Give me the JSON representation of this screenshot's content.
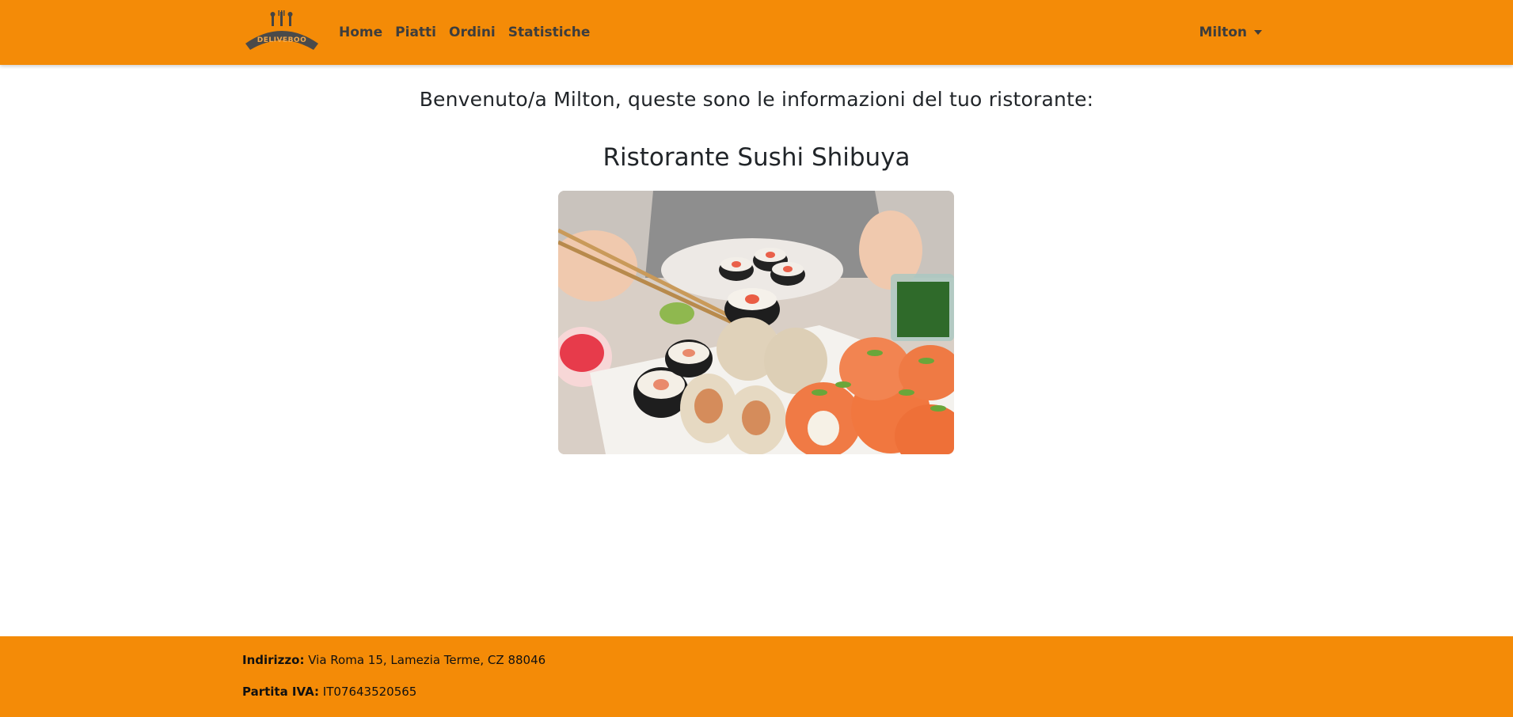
{
  "navbar": {
    "logo_text": "DELIVEBOO",
    "links": [
      "Home",
      "Piatti",
      "Ordini",
      "Statistiche"
    ],
    "user_name": "Milton"
  },
  "main": {
    "welcome": "Benvenuto/a Milton, queste sono le informazioni del tuo ristorante:",
    "restaurant_name": "Ristorante Sushi Shibuya"
  },
  "footer": {
    "address_label": "Indirizzo:",
    "address_value": "Via Roma 15, Lamezia Terme, CZ 88046",
    "vat_label": "Partita IVA:",
    "vat_value": "IT07643520565"
  },
  "colors": {
    "brand_orange": "#f48b07",
    "nav_text": "#3d3d3d"
  }
}
